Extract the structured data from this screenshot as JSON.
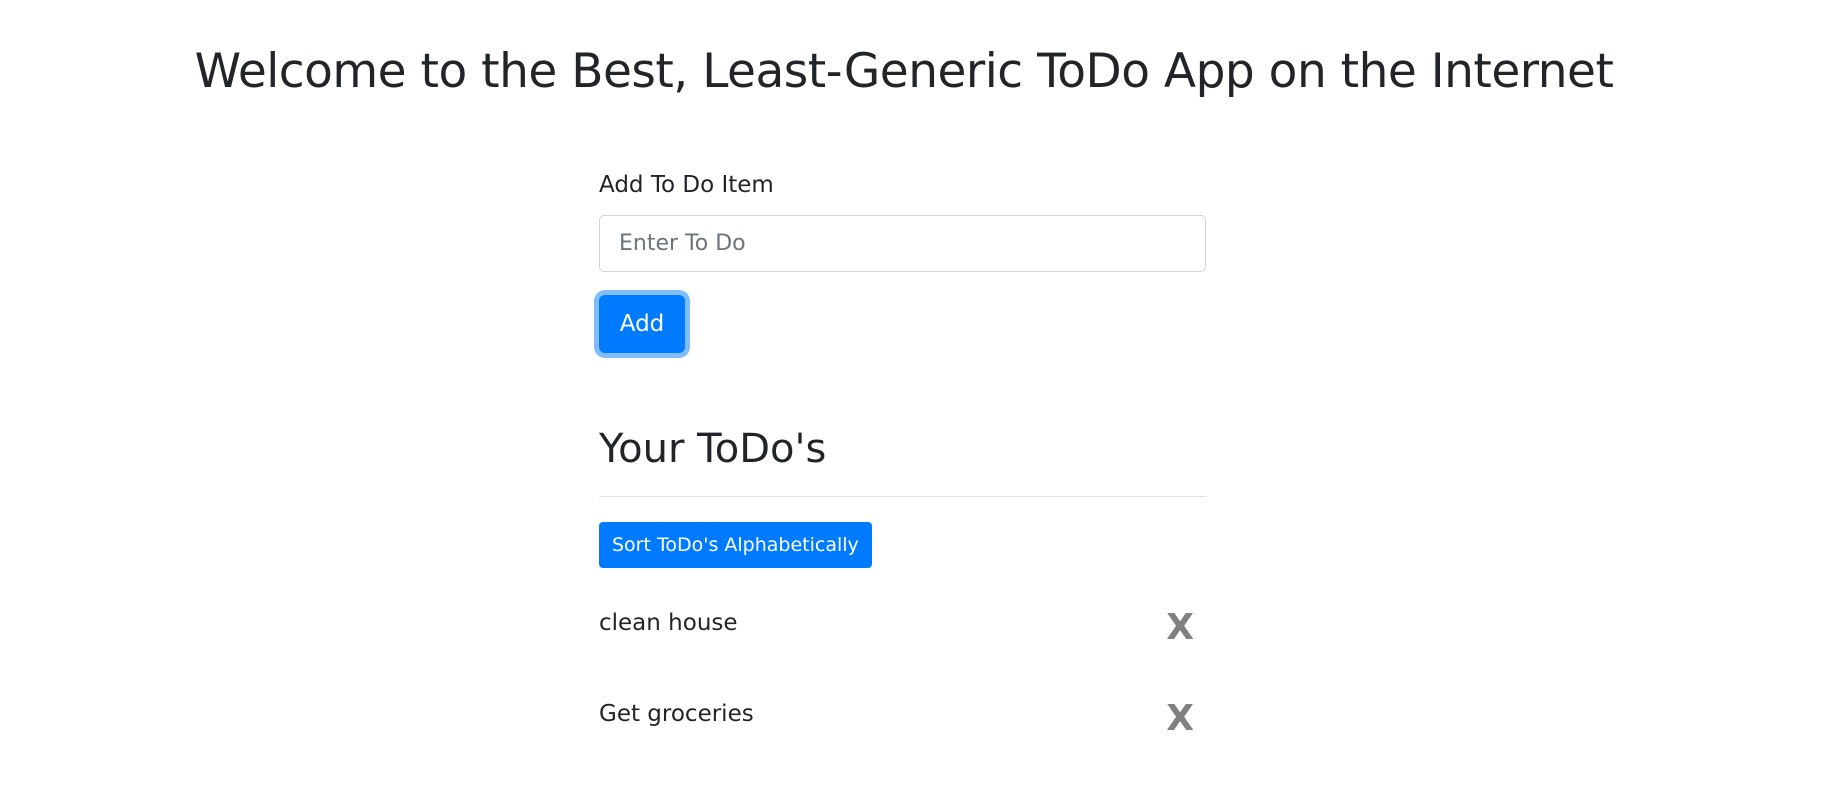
{
  "header": {
    "title": "Welcome to the Best, Least-Generic ToDo App on the Internet"
  },
  "add_form": {
    "label": "Add To Do Item",
    "input_value": "",
    "input_placeholder": "Enter To Do",
    "add_button_label": "Add"
  },
  "todos_section": {
    "heading": "Your ToDo's",
    "sort_button_label": "Sort ToDo's Alphabetically",
    "items": [
      {
        "text": "clean house",
        "delete_label": "X"
      },
      {
        "text": "Get groceries",
        "delete_label": "X"
      }
    ]
  },
  "colors": {
    "primary": "#007bff",
    "text": "#212529",
    "delete_icon": "#808080",
    "divider": "#dee2e6"
  },
  "icons": {
    "delete": "close-icon"
  }
}
